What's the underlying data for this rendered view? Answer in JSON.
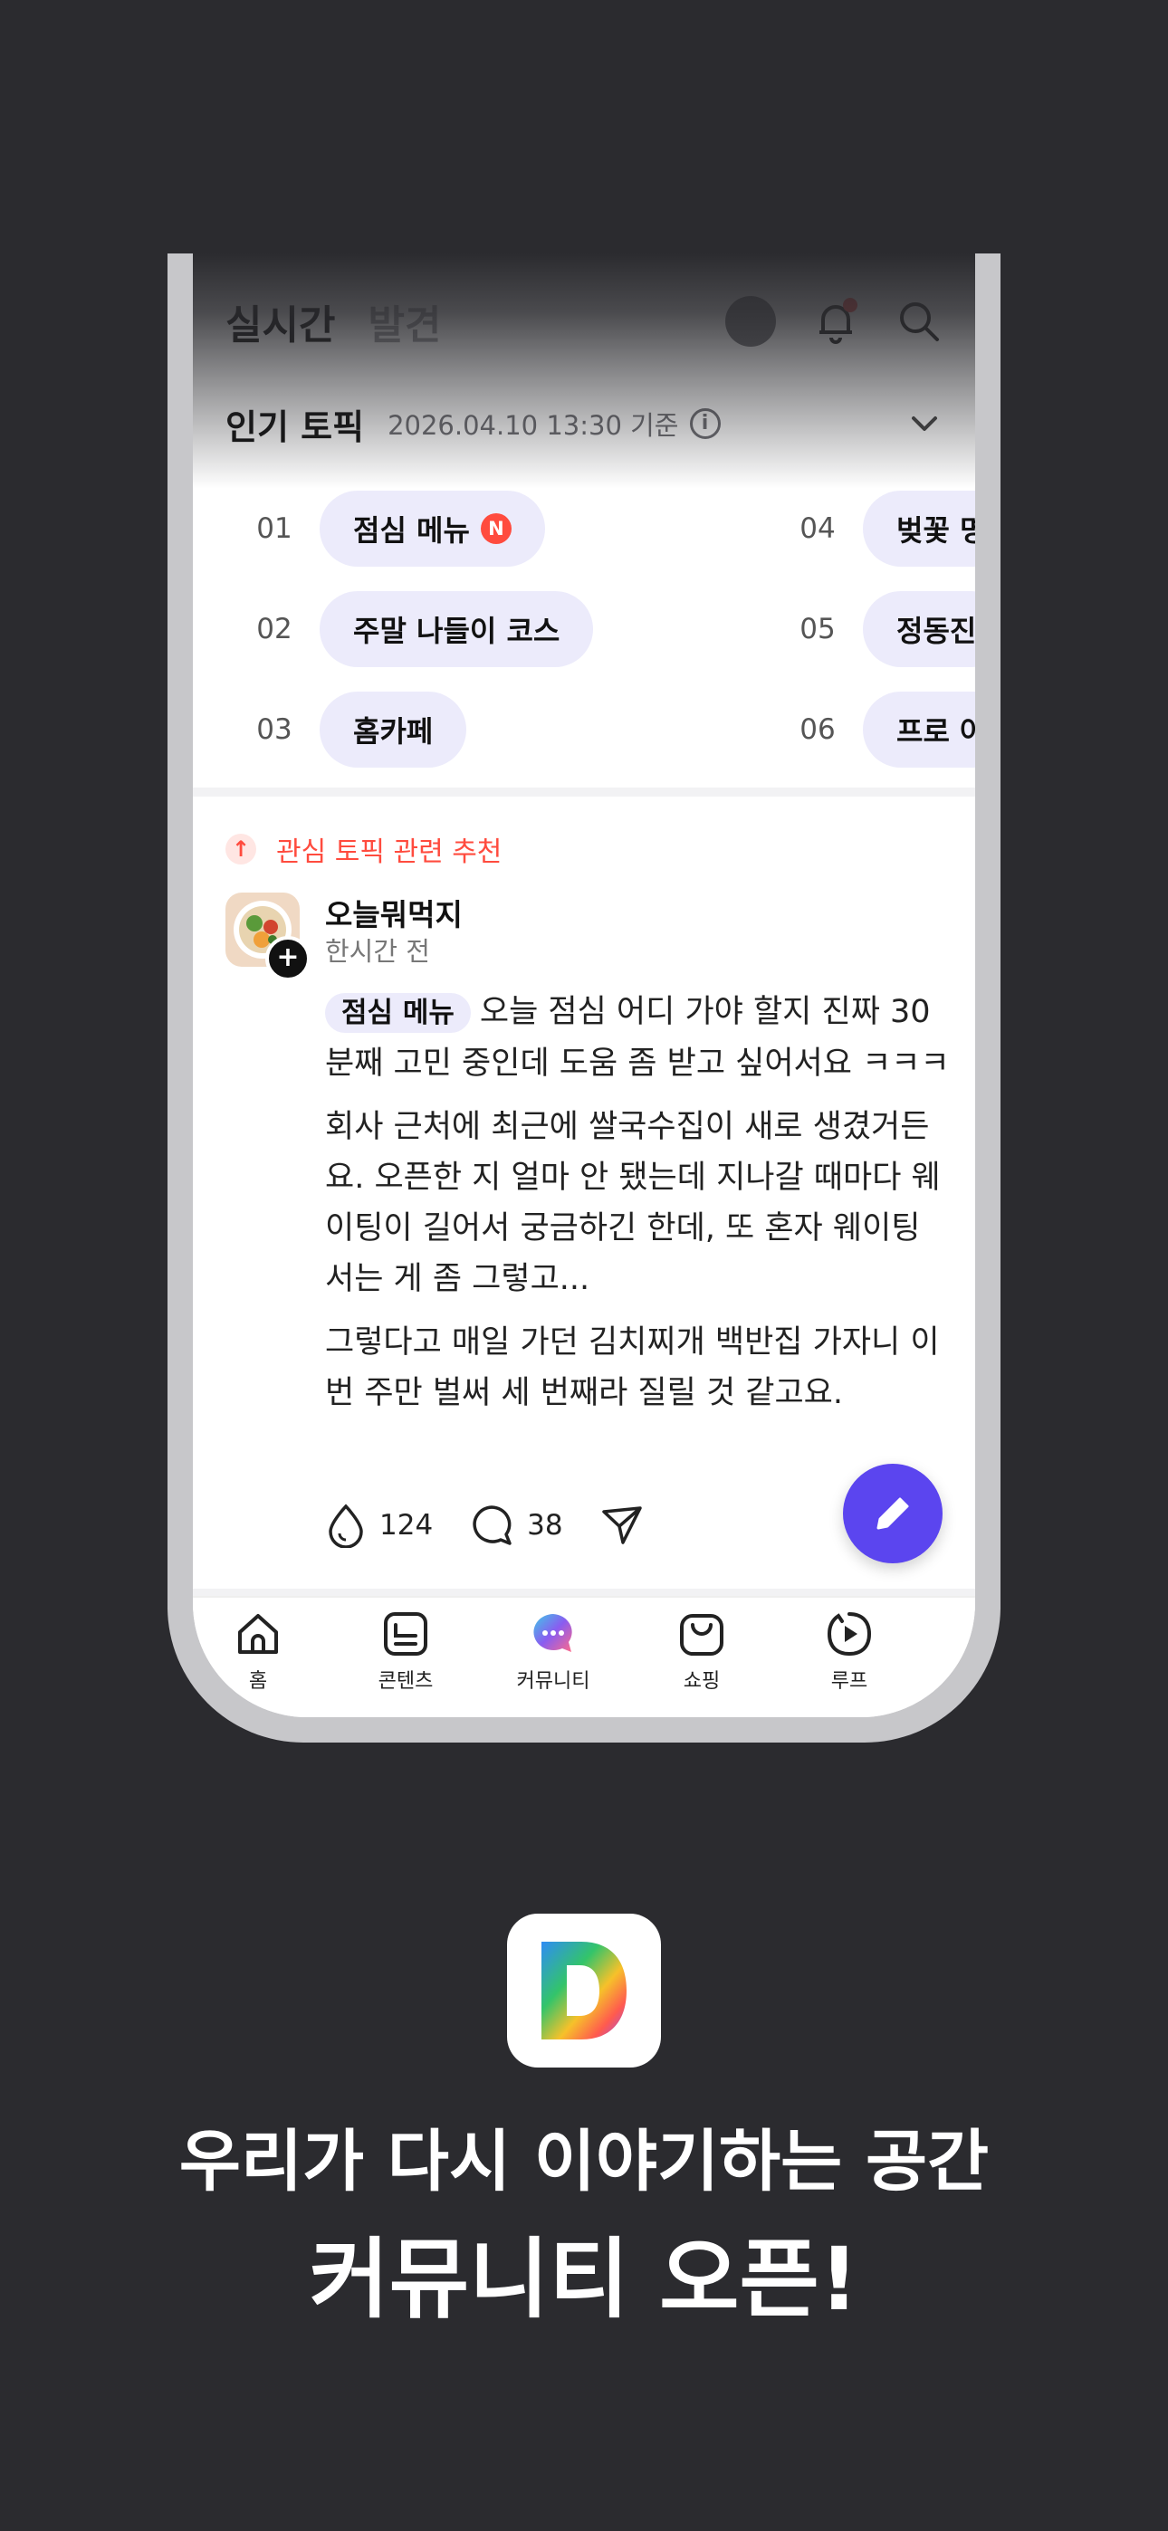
{
  "header": {
    "tab_live": "실시간",
    "tab_discover": "발견"
  },
  "popular_topics": {
    "title": "인기 토픽",
    "timestamp": "2026.04.10 13:30 기준",
    "new_badge": "N",
    "items": [
      {
        "rank": "01",
        "label": "점심 메뉴"
      },
      {
        "rank": "02",
        "label": "주말 나들이 코스"
      },
      {
        "rank": "03",
        "label": "홈카페"
      },
      {
        "rank": "04",
        "label": "벚꽃 명"
      },
      {
        "rank": "05",
        "label": "정동진"
      },
      {
        "rank": "06",
        "label": "프로 야"
      }
    ]
  },
  "recommendation": {
    "label": "관심 토픽 관련 추천"
  },
  "post": {
    "author": "오늘뭐먹지",
    "time": "한시간 전",
    "topic_tag": "점심 메뉴",
    "text1": "오늘 점심 어디 가야 할지 진짜 30분째 고민 중인데 도움 좀 받고 싶어서요 ㅋㅋㅋ",
    "text2": "회사 근처에 최근에 쌀국수집이 새로 생겼거든요. 오픈한 지 얼마 안 됐는데 지나갈 때마다 웨이팅이 길어서 궁금하긴 한데, 또 혼자 웨이팅 서는 게 좀 그렇고...",
    "text3": "그렇다고 매일 가던 김치찌개 백반집 가자니 이번 주만 벌써 세 번째라 질릴 것 같고요.",
    "likes": "124",
    "comments": "38"
  },
  "nav": {
    "home": "홈",
    "contents": "콘텐츠",
    "community": "커뮤니티",
    "shopping": "쇼핑",
    "loop": "루프"
  },
  "promo": {
    "line1": "우리가 다시 이야기하는 공간",
    "line2": "커뮤니티 오픈!"
  },
  "colors": {
    "accent": "#5b45ef",
    "pill": "#ecebfb",
    "alert": "#ff4b3e",
    "background": "#2b2b2f"
  }
}
